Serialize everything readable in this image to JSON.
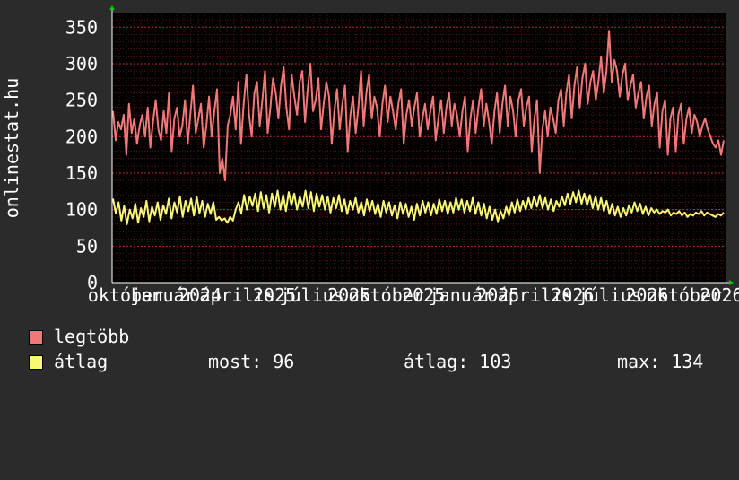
{
  "watermark": "onlinestat.hu",
  "chart_data": {
    "type": "line",
    "ylim": [
      0,
      370
    ],
    "y_ticks": [
      0,
      50,
      100,
      150,
      200,
      250,
      300,
      350
    ],
    "x_tick_labels": [
      "október",
      "január",
      "2024",
      "április",
      "2025",
      "július",
      "2025",
      "október",
      "2025",
      "január",
      "2025",
      "április",
      "2026",
      "július",
      "2026",
      "október",
      "2026"
    ],
    "grid": true,
    "background": "#000000",
    "grid_color": "#8b1a1a",
    "series": [
      {
        "name": "legtöbb",
        "color": "#f07878",
        "values": [
          235,
          195,
          220,
          210,
          230,
          175,
          245,
          205,
          225,
          190,
          215,
          230,
          200,
          240,
          185,
          220,
          250,
          210,
          195,
          235,
          205,
          260,
          180,
          225,
          240,
          200,
          215,
          250,
          190,
          230,
          270,
          205,
          225,
          245,
          185,
          215,
          255,
          200,
          235,
          265,
          150,
          170,
          140,
          215,
          230,
          255,
          210,
          275,
          190,
          245,
          285,
          230,
          200,
          260,
          275,
          215,
          250,
          290,
          205,
          240,
          280,
          260,
          225,
          270,
          295,
          240,
          210,
          285,
          255,
          230,
          275,
          290,
          220,
          265,
          300,
          235,
          250,
          280,
          210,
          245,
          275,
          255,
          190,
          235,
          265,
          210,
          245,
          270,
          180,
          230,
          255,
          205,
          240,
          290,
          215,
          260,
          285,
          225,
          255,
          240,
          200,
          245,
          270,
          220,
          255,
          235,
          210,
          245,
          265,
          190,
          230,
          250,
          215,
          240,
          260,
          200,
          225,
          245,
          210,
          235,
          255,
          195,
          225,
          250,
          205,
          240,
          260,
          215,
          245,
          230,
          200,
          235,
          255,
          180,
          225,
          250,
          205,
          240,
          265,
          215,
          245,
          220,
          190,
          235,
          260,
          205,
          245,
          270,
          215,
          255,
          235,
          200,
          250,
          265,
          215,
          240,
          255,
          180,
          225,
          250,
          150,
          210,
          235,
          200,
          240,
          225,
          205,
          250,
          265,
          215,
          260,
          285,
          225,
          270,
          295,
          240,
          280,
          300,
          245,
          275,
          290,
          250,
          275,
          310,
          260,
          290,
          345,
          275,
          305,
          290,
          255,
          285,
          300,
          250,
          270,
          285,
          240,
          260,
          275,
          225,
          255,
          270,
          215,
          245,
          260,
          185,
          235,
          250,
          175,
          225,
          240,
          180,
          230,
          245,
          190,
          225,
          240,
          205,
          230,
          220,
          200,
          215,
          225,
          210,
          200,
          190,
          185,
          195,
          175,
          195
        ]
      },
      {
        "name": "átlag",
        "color": "#f8f878",
        "values": [
          115,
          95,
          110,
          85,
          105,
          80,
          100,
          88,
          108,
          82,
          102,
          90,
          112,
          84,
          104,
          92,
          110,
          86,
          106,
          94,
          115,
          88,
          110,
          96,
          118,
          90,
          112,
          98,
          115,
          92,
          118,
          95,
          112,
          90,
          108,
          94,
          110,
          86,
          90,
          85,
          88,
          82,
          90,
          85,
          100,
          110,
          95,
          120,
          100,
          118,
          105,
          122,
          98,
          124,
          102,
          120,
          96,
          122,
          104,
          126,
          100,
          120,
          98,
          124,
          106,
          122,
          100,
          118,
          104,
          126,
          102,
          124,
          98,
          122,
          104,
          120,
          100,
          118,
          96,
          116,
          102,
          120,
          98,
          114,
          94,
          112,
          100,
          116,
          96,
          110,
          92,
          114,
          98,
          112,
          94,
          108,
          90,
          112,
          96,
          110,
          92,
          106,
          88,
          110,
          94,
          108,
          90,
          104,
          86,
          108,
          92,
          112,
          96,
          110,
          92,
          108,
          94,
          114,
          98,
          112,
          94,
          110,
          96,
          116,
          100,
          114,
          96,
          112,
          98,
          116,
          94,
          110,
          92,
          108,
          88,
          104,
          86,
          100,
          84,
          98,
          88,
          104,
          92,
          110,
          96,
          114,
          98,
          112,
          100,
          116,
          102,
          118,
          104,
          120,
          102,
          116,
          100,
          114,
          98,
          112,
          104,
          118,
          106,
          122,
          108,
          124,
          110,
          126,
          108,
          122,
          106,
          120,
          102,
          118,
          100,
          116,
          98,
          112,
          94,
          108,
          92,
          104,
          90,
          102,
          92,
          106,
          96,
          110,
          98,
          108,
          94,
          104,
          92,
          102,
          96,
          100,
          94,
          98,
          96,
          100,
          92,
          96,
          94,
          98,
          92,
          96,
          90,
          94,
          92,
          96,
          94,
          98,
          92,
          96,
          94,
          92,
          90,
          94,
          92,
          96
        ]
      }
    ]
  },
  "legend": {
    "max_label": "legtöbb",
    "avg_label": "átlag",
    "now": "most: 96",
    "avg": "átlag: 103",
    "max": "max: 134"
  }
}
